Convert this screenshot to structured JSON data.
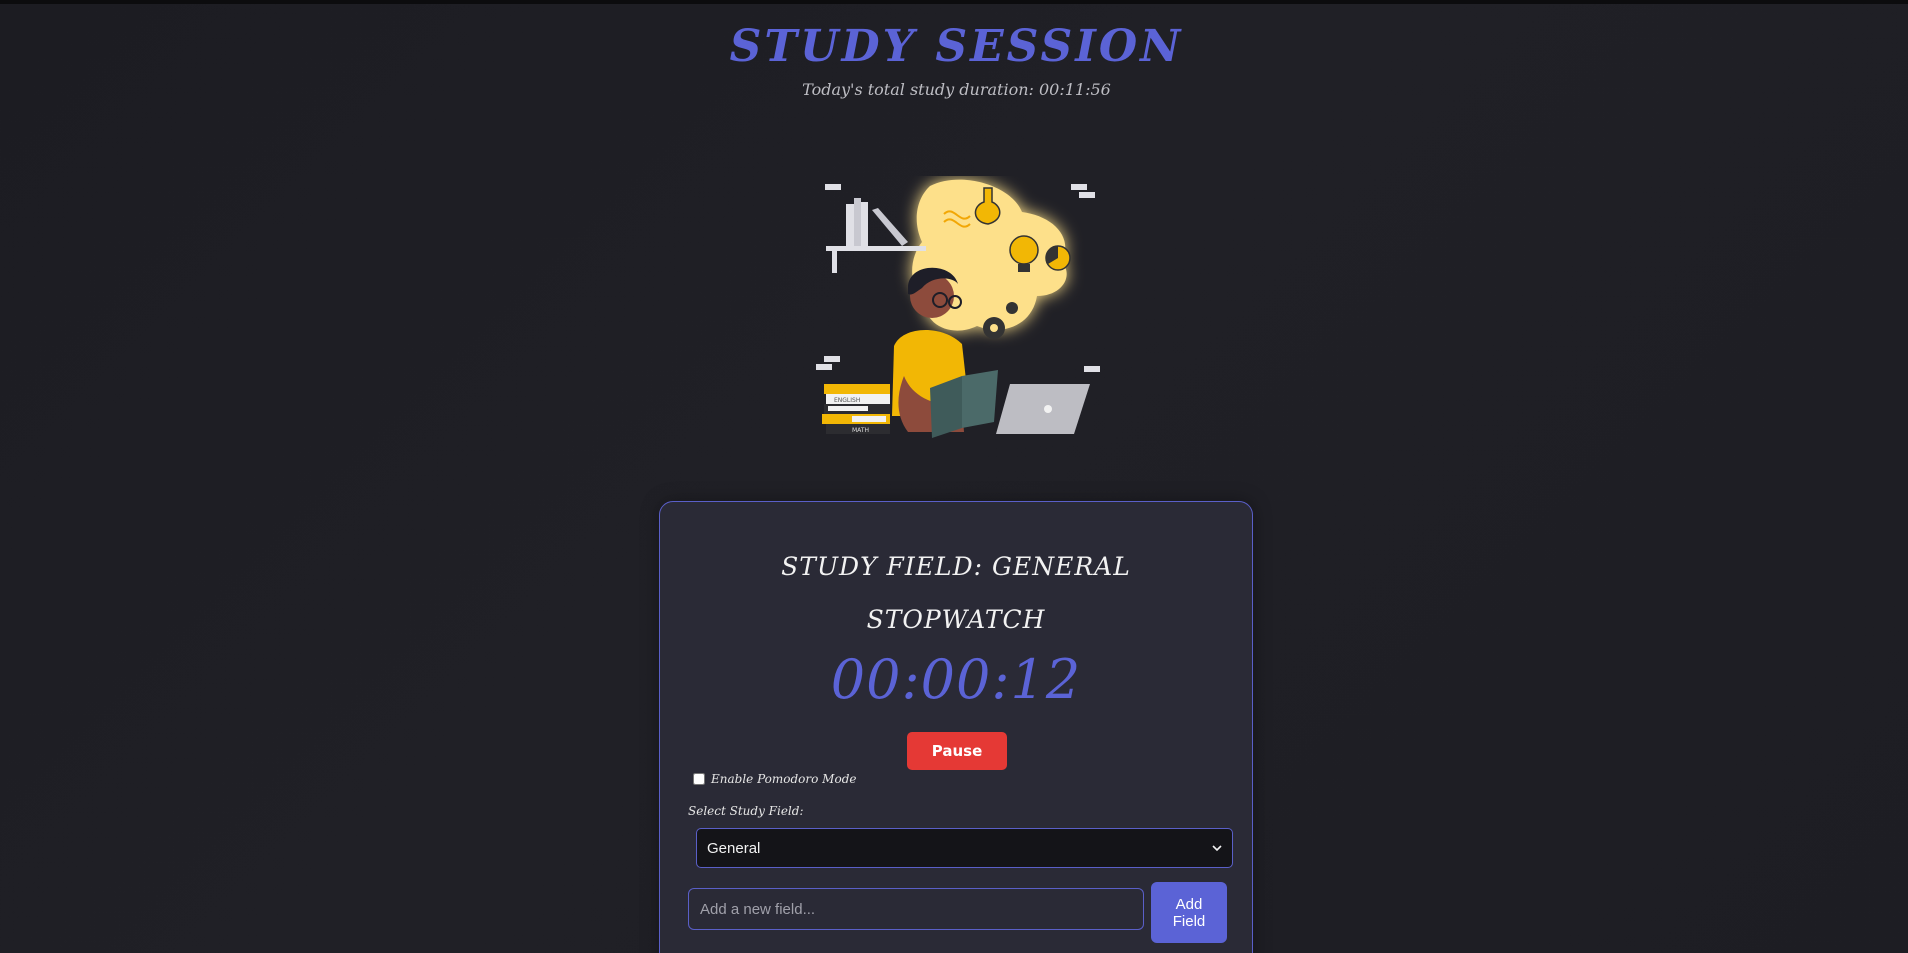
{
  "header": {
    "title": "STUDY SESSION",
    "total_prefix": "Today's total study duration: ",
    "total_value": "00:11:56"
  },
  "illustration": {
    "name": "student-study-illustration",
    "book_labels": [
      "ENGLISH",
      "MATH"
    ]
  },
  "session": {
    "field_heading": "STUDY FIELD: GENERAL",
    "mode_heading": "STOPWATCH",
    "timer": "00:00:12",
    "pause_label": "Pause",
    "pomodoro_label": "Enable Pomodoro Mode",
    "pomodoro_checked": false,
    "select_label": "Select Study Field:",
    "selected_field": "General",
    "new_field_placeholder": "Add a new field...",
    "add_field_label": "Add\nField"
  },
  "colors": {
    "accent": "#5b63d6",
    "pause": "#e53935",
    "panel_bg": "#2a2a36",
    "page_bg": "#1f1f25"
  }
}
